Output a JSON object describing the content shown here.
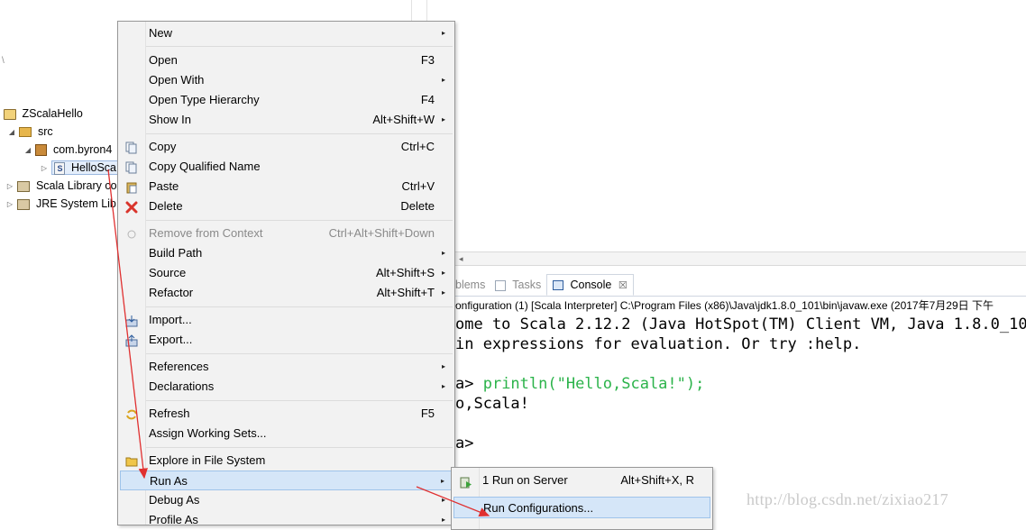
{
  "explorer": {
    "left_mark": "\\",
    "items": [
      {
        "label": "ZScalaHello",
        "twisty": "",
        "icon": "project-icon"
      },
      {
        "label": "src",
        "twisty": "◢",
        "icon": "source-folder-icon"
      },
      {
        "label": "com.byron4",
        "twisty": "◢",
        "icon": "package-icon"
      },
      {
        "label": "HelloSca",
        "twisty": "▷",
        "icon": "scala-file-icon"
      },
      {
        "label": "Scala Library co",
        "twisty": "▷",
        "icon": "library-icon"
      },
      {
        "label": "JRE System Lib",
        "twisty": "▷",
        "icon": "library-icon"
      }
    ]
  },
  "context_menu": {
    "items": [
      {
        "label": "New",
        "shortcut": "",
        "submenu": "▸"
      },
      {
        "label": "Open",
        "shortcut": "F3",
        "submenu": ""
      },
      {
        "label": "Open With",
        "shortcut": "",
        "submenu": "▸"
      },
      {
        "label": "Open Type Hierarchy",
        "shortcut": "F4",
        "submenu": ""
      },
      {
        "label": "Show In",
        "shortcut": "Alt+Shift+W",
        "submenu": "▸"
      },
      {
        "label": "Copy",
        "shortcut": "Ctrl+C",
        "submenu": ""
      },
      {
        "label": "Copy Qualified Name",
        "shortcut": "",
        "submenu": ""
      },
      {
        "label": "Paste",
        "shortcut": "Ctrl+V",
        "submenu": ""
      },
      {
        "label": "Delete",
        "shortcut": "Delete",
        "submenu": ""
      },
      {
        "label": "Remove from Context",
        "shortcut": "Ctrl+Alt+Shift+Down",
        "submenu": ""
      },
      {
        "label": "Build Path",
        "shortcut": "",
        "submenu": "▸"
      },
      {
        "label": "Source",
        "shortcut": "Alt+Shift+S",
        "submenu": "▸"
      },
      {
        "label": "Refactor",
        "shortcut": "Alt+Shift+T",
        "submenu": "▸"
      },
      {
        "label": "Import...",
        "shortcut": "",
        "submenu": ""
      },
      {
        "label": "Export...",
        "shortcut": "",
        "submenu": ""
      },
      {
        "label": "References",
        "shortcut": "",
        "submenu": "▸"
      },
      {
        "label": "Declarations",
        "shortcut": "",
        "submenu": "▸"
      },
      {
        "label": "Refresh",
        "shortcut": "F5",
        "submenu": ""
      },
      {
        "label": "Assign Working Sets...",
        "shortcut": "",
        "submenu": ""
      },
      {
        "label": "Explore in File System",
        "shortcut": "",
        "submenu": ""
      },
      {
        "label": "Run As",
        "shortcut": "",
        "submenu": "▸"
      },
      {
        "label": "Debug As",
        "shortcut": "",
        "submenu": "▸"
      },
      {
        "label": "Profile As",
        "shortcut": "",
        "submenu": "▸"
      }
    ]
  },
  "run_as_submenu": {
    "items": [
      {
        "label": "1 Run on Server",
        "shortcut": "Alt+Shift+X, R"
      },
      {
        "label": "Run Configurations...",
        "shortcut": ""
      }
    ]
  },
  "console": {
    "tabs": [
      "blems",
      "Tasks",
      "Console"
    ],
    "close_glyph": "☒",
    "description": "onfiguration (1) [Scala Interpreter] C:\\Program Files (x86)\\Java\\jdk1.8.0_101\\bin\\javaw.exe (2017年7月29日 下午",
    "lines": [
      {
        "prefix": "ome to Scala 2.12.2 (Java HotSpot(TM) Client VM, Java 1.8.0_101)",
        "input": ""
      },
      {
        "prefix": " in expressions for evaluation. Or try :help.",
        "input": ""
      },
      {
        "prefix": "",
        "input": ""
      },
      {
        "prefix": "a> ",
        "input": "println(\"Hello,Scala!\");"
      },
      {
        "prefix": "o,Scala!",
        "input": ""
      },
      {
        "prefix": "",
        "input": ""
      },
      {
        "prefix": "a>",
        "input": ""
      }
    ],
    "scroll_left_glyph": "◂"
  },
  "watermark": "http://blog.csdn.net/zixiao217",
  "colors": {
    "menu_bg": "#f2f2f2",
    "highlight": "#d5e6f8",
    "console_input": "#2bb34a",
    "annotation_arrow": "#e03030",
    "disabled_text": "#8a8a8a"
  }
}
